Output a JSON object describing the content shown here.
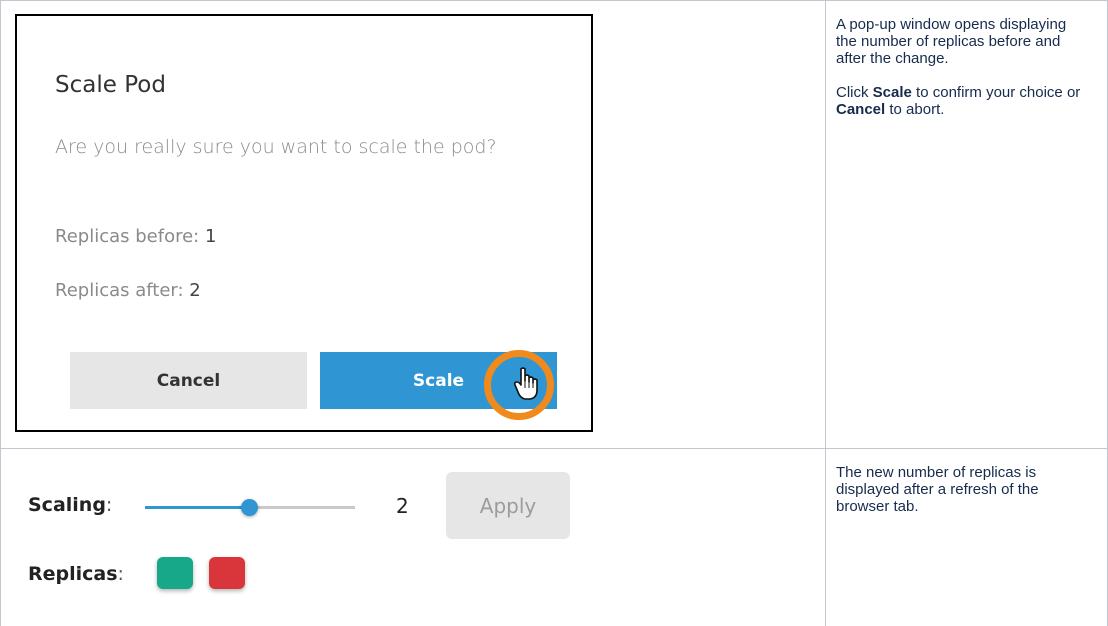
{
  "dialog": {
    "title": "Scale Pod",
    "question": "Are you really sure you want to scale the pod?",
    "replicas_before_label": "Replicas before:",
    "replicas_before_value": "1",
    "replicas_after_label": "Replicas after:",
    "replicas_after_value": "2",
    "cancel_label": "Cancel",
    "scale_label": "Scale",
    "highlight_color": "#f08a1c",
    "scale_button_color": "#2f96d3"
  },
  "step1": {
    "text": "A pop-up window opens displaying the number of replicas before and after the change.",
    "click": "Click",
    "scale_word": "Scale",
    "middle": "to confirm your choice or",
    "cancel_word": "Cancel",
    "end": "to abort."
  },
  "widget": {
    "scaling_label": "Scaling",
    "replicas_label": "Replicas",
    "colon": ":",
    "slider_value": "2",
    "slider_fraction": 0.5,
    "apply_label": "Apply",
    "replica_colors": [
      "#17a88a",
      "#d9363c"
    ]
  },
  "step2": {
    "text": "The new number of replicas is displayed after a refresh of the browser tab."
  }
}
